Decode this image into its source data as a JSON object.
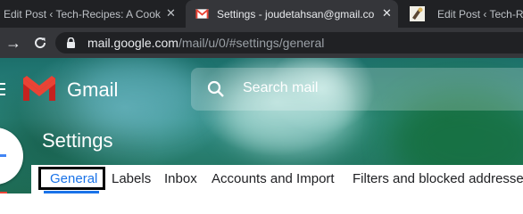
{
  "browser": {
    "tabs": [
      {
        "title": "Edit Post ‹ Tech-Recipes: A Cookbo",
        "favicon": "",
        "active": false
      },
      {
        "title": "Settings - joudetahsan@gmail.co",
        "favicon": "gmail-icon",
        "active": true
      },
      {
        "title": "Edit Post ‹ Tech-Recipes: A",
        "favicon": "tech-recipes-icon",
        "active": false
      }
    ],
    "close_glyph": "✕",
    "toolbar": {
      "back_glyph": "→",
      "reload_glyph": "C",
      "url_host": "mail.google.com",
      "url_path": "/mail/u/0/#settings/general"
    }
  },
  "gmail": {
    "product_name": "Gmail",
    "search_placeholder": "Search mail",
    "page_title": "Settings",
    "settings_tabs": [
      "General",
      "Labels",
      "Inbox",
      "Accounts and Import",
      "Filters and blocked addresses"
    ],
    "selected_tab": "General"
  },
  "colors": {
    "accent": "#1a73e8",
    "gmail_red": "#ea4335",
    "tabstrip": "#202124",
    "toolbar": "#35363a"
  }
}
